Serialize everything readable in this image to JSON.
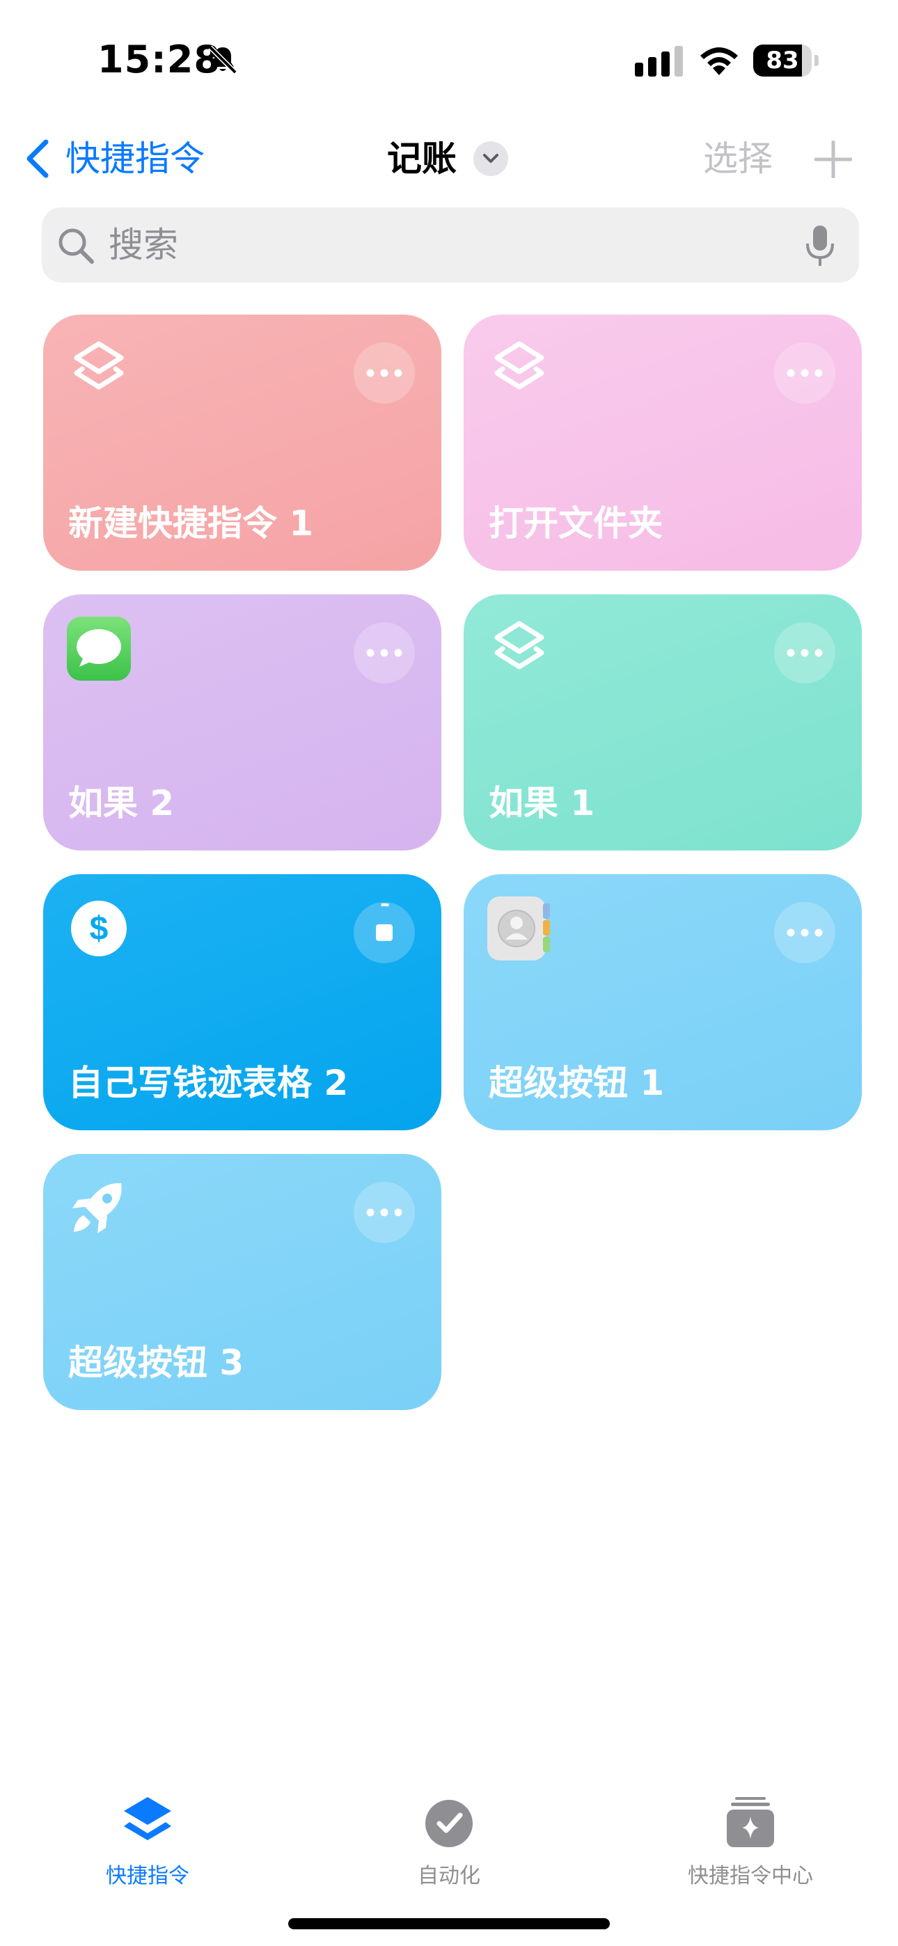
{
  "status_bar": {
    "time": "15:28",
    "battery_level": "83"
  },
  "nav": {
    "back_label": "快捷指令",
    "title": "记账",
    "select_label": "选择"
  },
  "search": {
    "placeholder": "搜索"
  },
  "colors": {
    "accent": "#0a7aff",
    "inactive": "#8e8e93"
  },
  "shortcuts": [
    {
      "title": "新建快捷指令 1",
      "icon": "shortcuts-layers-icon",
      "color": "#f6a9aa"
    },
    {
      "title": "打开文件夹",
      "icon": "shortcuts-layers-icon",
      "color": "#f8c3e9"
    },
    {
      "title": "如果 2",
      "icon": "messages-app-icon",
      "color": "#d9b8f0"
    },
    {
      "title": "如果 1",
      "icon": "shortcuts-layers-icon",
      "color": "#84e4d2"
    },
    {
      "title": "自己写钱迹表格 2",
      "icon": "dollar-icon",
      "color": "#08a9f0"
    },
    {
      "title": "超级按钮 1",
      "icon": "contacts-app-icon",
      "color": "#80d3f8"
    },
    {
      "title": "超级按钮 3",
      "icon": "rocket-icon",
      "color": "#80d3f8"
    }
  ],
  "tabs": [
    {
      "label": "快捷指令",
      "icon": "shortcuts-tab-icon",
      "active": true
    },
    {
      "label": "自动化",
      "icon": "automation-tab-icon",
      "active": false
    },
    {
      "label": "快捷指令中心",
      "icon": "gallery-tab-icon",
      "active": false
    }
  ]
}
